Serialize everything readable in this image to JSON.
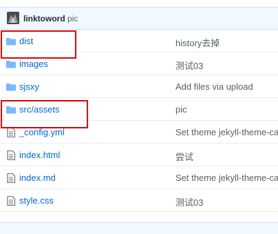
{
  "commit": {
    "author": "linktoword",
    "message": "pic"
  },
  "files": [
    {
      "type": "folder",
      "name": "dist",
      "message": "history去掉"
    },
    {
      "type": "folder",
      "name": "images",
      "message": "测试03"
    },
    {
      "type": "folder",
      "name": "sjsxy",
      "message": "Add files via upload"
    },
    {
      "type": "folder",
      "name": "src/assets",
      "message": "pic"
    },
    {
      "type": "file",
      "name": "_config.yml",
      "message": "Set theme jekyll-theme-cayman"
    },
    {
      "type": "file",
      "name": "index.html",
      "message": "尝试"
    },
    {
      "type": "file",
      "name": "index.md",
      "message": "Set theme jekyll-theme-cayman"
    },
    {
      "type": "file",
      "name": "style.css",
      "message": "测试03"
    }
  ],
  "colors": {
    "link": "#0366d6",
    "folder_icon": "#79b8ff",
    "file_icon": "#6a737d",
    "highlight_border": "#e00000",
    "header_bg": "#f1f8ff"
  }
}
